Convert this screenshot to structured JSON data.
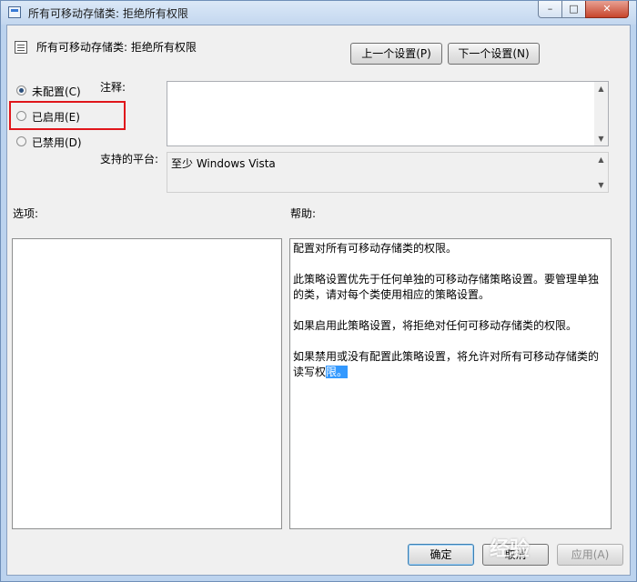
{
  "window": {
    "title": "所有可移动存储类: 拒绝所有权限",
    "controls": {
      "minimize": "–",
      "maximize": "□",
      "close": "✕"
    }
  },
  "policy": {
    "name": "所有可移动存储类: 拒绝所有权限",
    "prev_button": "上一个设置(P)",
    "next_button": "下一个设置(N)"
  },
  "state_options": [
    {
      "label": "未配置(C)",
      "checked": true
    },
    {
      "label": "已启用(E)",
      "checked": false
    },
    {
      "label": "已禁用(D)",
      "checked": false
    }
  ],
  "comment": {
    "label": "注释:",
    "value": ""
  },
  "platform": {
    "label": "支持的平台:",
    "value": "至少 Windows Vista"
  },
  "options": {
    "label": "选项:"
  },
  "help": {
    "label": "帮助:",
    "paragraphs": [
      "配置对所有可移动存储类的权限。",
      "此策略设置优先于任何单独的可移动存储策略设置。要管理单独的类，请对每个类使用相应的策略设置。",
      "如果启用此策略设置，将拒绝对任何可移动存储类的权限。"
    ],
    "last_paragraph_plain": "如果禁用或没有配置此策略设置，将允许对所有可移动存储类的读写权",
    "last_paragraph_selected": "限。"
  },
  "footer": {
    "ok": "确定",
    "cancel": "取消",
    "apply": "应用(A)"
  },
  "colors": {
    "highlight_box": "#e0161b",
    "selection": "#3399ff",
    "accent": "#3c7fb1"
  },
  "icons": [
    "policy-icon",
    "radio-icon",
    "scroll-up-icon",
    "scroll-down-icon"
  ],
  "watermark": "经验"
}
